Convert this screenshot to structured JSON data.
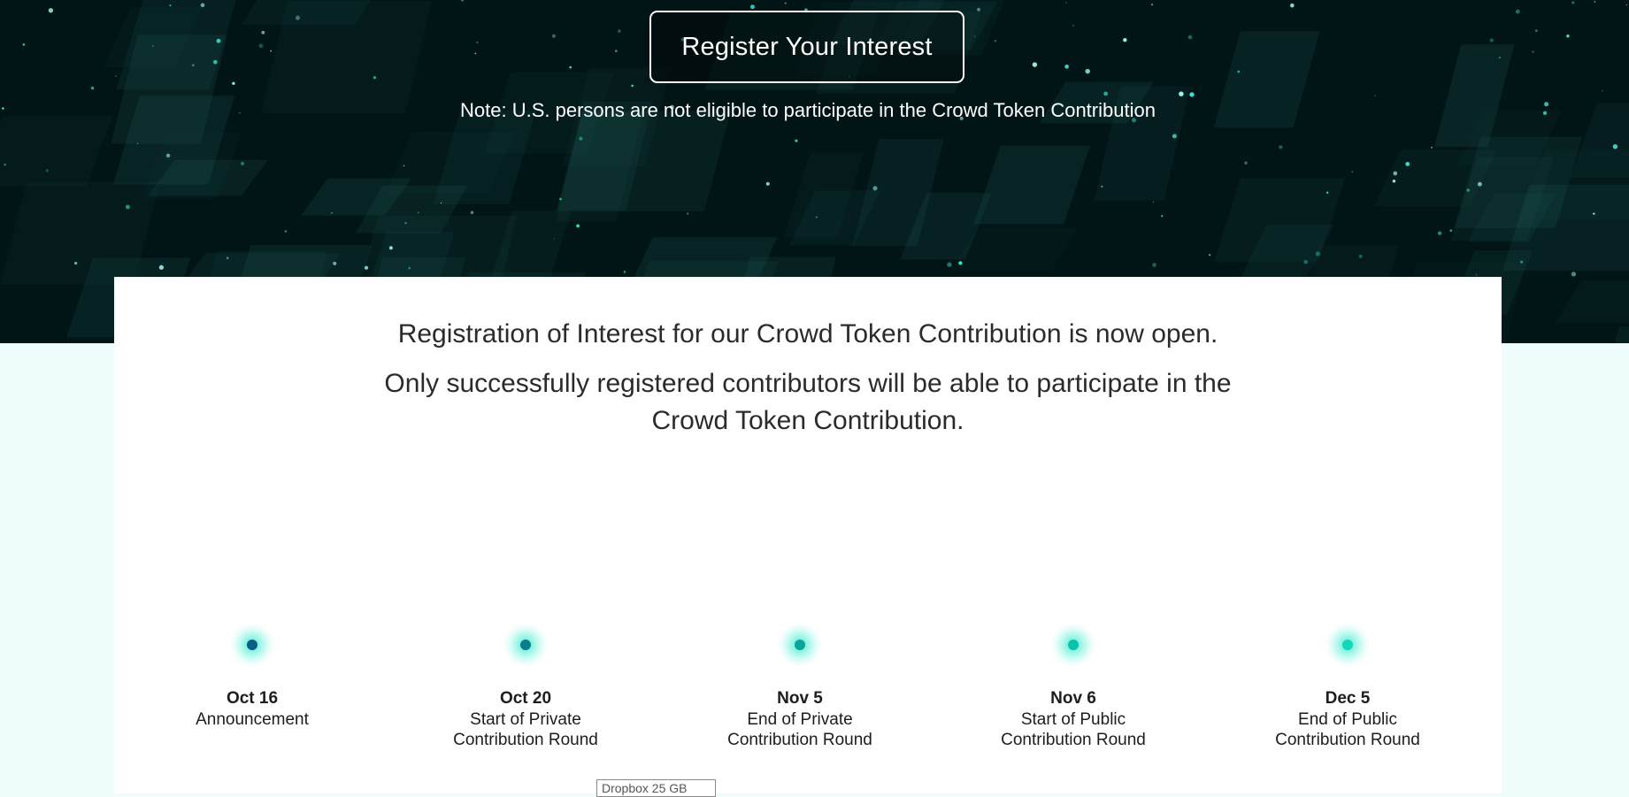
{
  "hero": {
    "register_button": "Register Your Interest",
    "note": "Note: U.S. persons are not eligible to participate in the Crowd Token Contribution"
  },
  "intro": {
    "line1": "Registration of Interest for our Crowd Token Contribution is now open.",
    "line2": "Only successfully registered contributors will be able to participate in the Crowd Token Contribution."
  },
  "timeline": {
    "milestones": [
      {
        "date": "Oct 16",
        "label": "Announcement",
        "color": "#0a5d86"
      },
      {
        "date": "Oct 20",
        "label": "Start of Private Contribution Round",
        "color": "#0b7e8d"
      },
      {
        "date": "Nov 5",
        "label": "End of Private Contribution Round",
        "color": "#0aa59b"
      },
      {
        "date": "Nov 6",
        "label": "Start of Public Contribution Round",
        "color": "#0bc2aa"
      },
      {
        "date": "Dec 5",
        "label": "End of Public Contribution Round",
        "color": "#12d6b8"
      }
    ]
  },
  "tooltip": {
    "text": "Dropbox 25 GB"
  },
  "colors": {
    "hero_background": "#021516",
    "page_background": "#effcfc",
    "timeline_start": "#0a4f86",
    "timeline_end": "#18e0bd"
  }
}
